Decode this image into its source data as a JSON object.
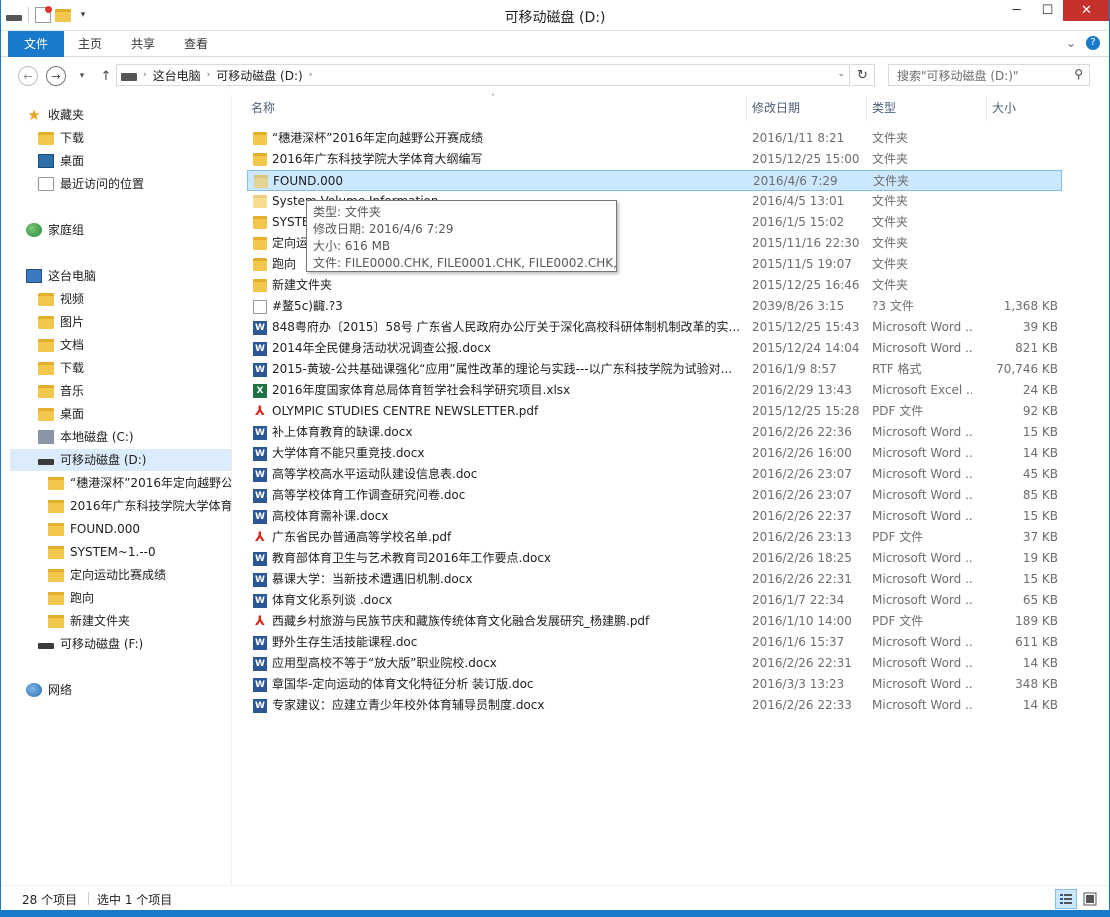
{
  "window": {
    "title": "可移动磁盘 (D:)"
  },
  "ribbon": {
    "tabs": [
      "文件",
      "主页",
      "共享",
      "查看"
    ]
  },
  "address": {
    "crumbs": [
      "这台电脑",
      "可移动磁盘 (D:)"
    ],
    "search_placeholder": "搜索\"可移动磁盘 (D:)\""
  },
  "nav": {
    "favorites": "收藏夹",
    "fav_items": [
      "下载",
      "桌面",
      "最近访问的位置"
    ],
    "homegroup": "家庭组",
    "thispc": "这台电脑",
    "pc_items": [
      "视频",
      "图片",
      "文档",
      "下载",
      "音乐",
      "桌面"
    ],
    "local_c": "本地磁盘 (C:)",
    "removable_d": "可移动磁盘 (D:)",
    "d_children": [
      "“穗港深杯”2016年定向越野公开赛成绩",
      "2016年广东科技学院大学体育大纲编写",
      "FOUND.000",
      "SYSTEM~1.--0",
      "定向运动比赛成绩",
      "跑向",
      "新建文件夹"
    ],
    "removable_f": "可移动磁盘 (F:)",
    "network": "网络"
  },
  "columns": {
    "name": "名称",
    "date": "修改日期",
    "type": "类型",
    "size": "大小"
  },
  "files": [
    {
      "name": "“穗港深杯”2016年定向越野公开赛成绩",
      "date": "2016/1/11 8:21",
      "type": "文件夹",
      "size": "",
      "icon": "folder"
    },
    {
      "name": "2016年广东科技学院大学体育大纲编写",
      "date": "2015/12/25 15:00",
      "type": "文件夹",
      "size": "",
      "icon": "folder"
    },
    {
      "name": "FOUND.000",
      "date": "2016/4/6 7:29",
      "type": "文件夹",
      "size": "",
      "icon": "folder",
      "selected": true
    },
    {
      "name": "System Volume Information",
      "date": "2016/4/5 13:01",
      "type": "文件夹",
      "size": "",
      "icon": "folder"
    },
    {
      "name": "SYSTEM~1.--0",
      "date": "2016/1/5 15:02",
      "type": "文件夹",
      "size": "",
      "icon": "folder"
    },
    {
      "name": "定向运动比赛成绩",
      "date": "2015/11/16 22:30",
      "type": "文件夹",
      "size": "",
      "icon": "folder"
    },
    {
      "name": "跑向",
      "date": "2015/11/5 19:07",
      "type": "文件夹",
      "size": "",
      "icon": "folder"
    },
    {
      "name": "新建文件夹",
      "date": "2015/12/25 16:46",
      "type": "文件夹",
      "size": "",
      "icon": "folder"
    },
    {
      "name": "#鳌5c)齱.?3",
      "date": "2039/8/26 3:15",
      "type": "?3 文件",
      "size": "1,368 KB",
      "icon": "doc"
    },
    {
      "name": "848粤府办〔2015〕58号 广东省人民政府办公厅关于深化高校科研体制机制改革的实...",
      "date": "2015/12/25 15:43",
      "type": "Microsoft Word ...",
      "size": "39 KB",
      "icon": "word"
    },
    {
      "name": "2014年全民健身活动状况调查公报.docx",
      "date": "2015/12/24 14:04",
      "type": "Microsoft Word ...",
      "size": "821 KB",
      "icon": "word"
    },
    {
      "name": "2015-黄玻-公共基础课强化“应用”属性改革的理论与实践---以广东科技学院为试验对...",
      "date": "2016/1/9 8:57",
      "type": "RTF 格式",
      "size": "70,746 KB",
      "icon": "word"
    },
    {
      "name": "2016年度国家体育总局体育哲学社会科学研究项目.xlsx",
      "date": "2016/2/29 13:43",
      "type": "Microsoft Excel ...",
      "size": "24 KB",
      "icon": "excel"
    },
    {
      "name": "OLYMPIC STUDIES CENTRE NEWSLETTER.pdf",
      "date": "2015/12/25 15:28",
      "type": "PDF 文件",
      "size": "92 KB",
      "icon": "pdf"
    },
    {
      "name": "补上体育教育的缺课.docx",
      "date": "2016/2/26 22:36",
      "type": "Microsoft Word ...",
      "size": "15 KB",
      "icon": "word"
    },
    {
      "name": "大学体育不能只重竞技.docx",
      "date": "2016/2/26 16:00",
      "type": "Microsoft Word ...",
      "size": "14 KB",
      "icon": "word"
    },
    {
      "name": "高等学校高水平运动队建设信息表.doc",
      "date": "2016/2/26 23:07",
      "type": "Microsoft Word ...",
      "size": "45 KB",
      "icon": "word"
    },
    {
      "name": "高等学校体育工作调查研究问卷.doc",
      "date": "2016/2/26 23:07",
      "type": "Microsoft Word ...",
      "size": "85 KB",
      "icon": "word"
    },
    {
      "name": "高校体育需补课.docx",
      "date": "2016/2/26 22:37",
      "type": "Microsoft Word ...",
      "size": "15 KB",
      "icon": "word"
    },
    {
      "name": "广东省民办普通高等学校名单.pdf",
      "date": "2016/2/26 23:13",
      "type": "PDF 文件",
      "size": "37 KB",
      "icon": "pdf"
    },
    {
      "name": "教育部体育卫生与艺术教育司2016年工作要点.docx",
      "date": "2016/2/26 18:25",
      "type": "Microsoft Word ...",
      "size": "19 KB",
      "icon": "word"
    },
    {
      "name": "慕课大学：当新技术遭遇旧机制.docx",
      "date": "2016/2/26 22:31",
      "type": "Microsoft Word ...",
      "size": "15 KB",
      "icon": "word"
    },
    {
      "name": "体育文化系列谈 .docx",
      "date": "2016/1/7 22:34",
      "type": "Microsoft Word ...",
      "size": "65 KB",
      "icon": "word"
    },
    {
      "name": "西藏乡村旅游与民族节庆和藏族传统体育文化融合发展研究_杨建鹏.pdf",
      "date": "2016/1/10 14:00",
      "type": "PDF 文件",
      "size": "189 KB",
      "icon": "pdf"
    },
    {
      "name": "野外生存生活技能课程.doc",
      "date": "2016/1/6 15:37",
      "type": "Microsoft Word ...",
      "size": "611 KB",
      "icon": "word"
    },
    {
      "name": "应用型高校不等于“放大版”职业院校.docx",
      "date": "2016/2/26 22:31",
      "type": "Microsoft Word ...",
      "size": "14 KB",
      "icon": "word"
    },
    {
      "name": "章国华-定向运动的体育文化特征分析 装订版.doc",
      "date": "2016/3/3 13:23",
      "type": "Microsoft Word ...",
      "size": "348 KB",
      "icon": "word"
    },
    {
      "name": "专家建议：应建立青少年校外体育辅导员制度.docx",
      "date": "2016/2/26 22:33",
      "type": "Microsoft Word ...",
      "size": "14 KB",
      "icon": "word"
    }
  ],
  "tooltip": {
    "line1": "类型: 文件夹",
    "line2": "修改日期: 2016/4/6 7:29",
    "line3": "大小: 616 MB",
    "line4": "文件: FILE0000.CHK, FILE0001.CHK, FILE0002.CHK, ..."
  },
  "status": {
    "count": "28 个项目",
    "selected": "选中 1 个项目"
  },
  "colors": {
    "accent": "#1979ca",
    "selection": "#cce8ff",
    "close": "#c7312c"
  }
}
